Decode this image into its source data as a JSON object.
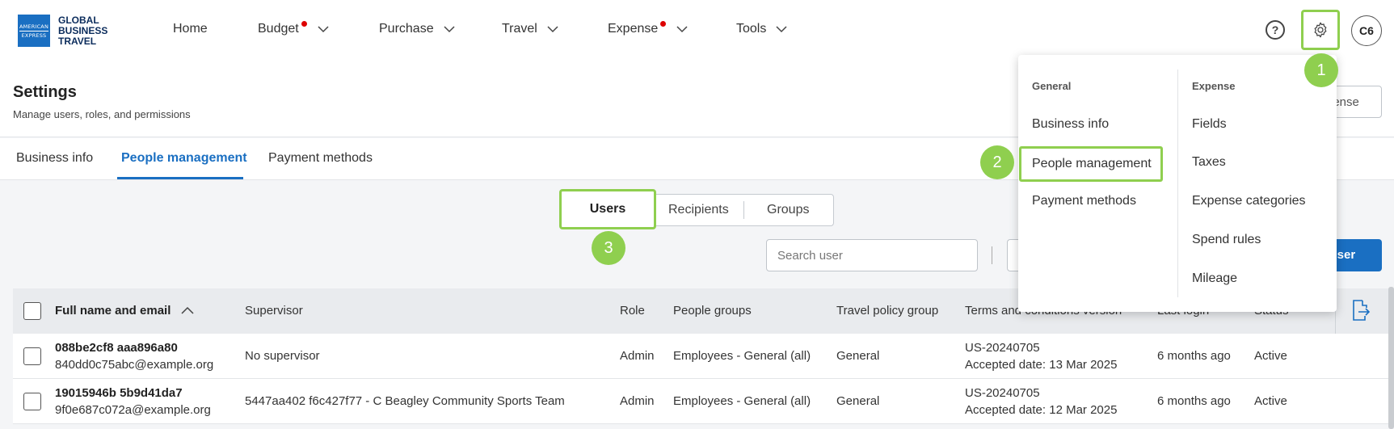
{
  "logo": {
    "box_line1": "AMERICAN",
    "box_line2": "EXPRESS",
    "line1": "GLOBAL",
    "line2": "BUSINESS",
    "line3": "TRAVEL"
  },
  "nav": {
    "home": "Home",
    "budget": "Budget",
    "purchase": "Purchase",
    "travel": "Travel",
    "expense": "Expense",
    "tools": "Tools"
  },
  "header_icons": {
    "help": "?",
    "avatar": "C6"
  },
  "settings": {
    "title": "Settings",
    "subtitle": "Manage users, roles, and permissions",
    "partial_button": "pense"
  },
  "tabs": [
    "Business info",
    "People management",
    "Payment methods"
  ],
  "segment": [
    "Users",
    "Recipients",
    "Groups"
  ],
  "search": {
    "placeholder": "Search user"
  },
  "add_user": {
    "label": "e user"
  },
  "table": {
    "headers": [
      "Full name and email",
      "Supervisor",
      "Role",
      "People groups",
      "Travel policy group",
      "Terms and conditions version",
      "Last login",
      "Status"
    ],
    "rows": [
      {
        "name": "088be2cf8 aaa896a80",
        "email": "840dd0c75abc@example.org",
        "supervisor": "No supervisor",
        "role": "Admin",
        "groups": "Employees - General (all)",
        "policy": "General",
        "terms": "US-20240705",
        "accepted": "Accepted date: 13 Mar 2025",
        "last_login": "6 months ago",
        "status": "Active"
      },
      {
        "name": "19015946b 5b9d41da7",
        "email": "9f0e687c072a@example.org",
        "supervisor": "5447aa402 f6c427f77 - C Beagley Community Sports Team",
        "role": "Admin",
        "groups": "Employees - General (all)",
        "policy": "General",
        "terms": "US-20240705",
        "accepted": "Accepted date: 12 Mar 2025",
        "last_login": "6 months ago",
        "status": "Active"
      }
    ]
  },
  "menu": {
    "general_head": "General",
    "general_items": [
      "Business info",
      "People management",
      "Payment methods"
    ],
    "expense_head": "Expense",
    "expense_items": [
      "Fields",
      "Taxes",
      "Expense categories",
      "Spend rules",
      "Mileage"
    ]
  },
  "badges": [
    "1",
    "2",
    "3"
  ],
  "colors": {
    "accent": "#1a6fc2",
    "highlight": "#8fcf4f",
    "notification": "#dd0000"
  }
}
